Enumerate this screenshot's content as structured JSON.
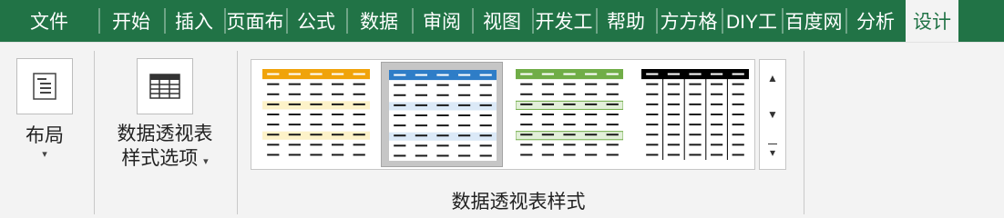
{
  "tabs": [
    {
      "id": "file",
      "label": "文件"
    },
    {
      "id": "home",
      "label": "开始"
    },
    {
      "id": "insert",
      "label": "插入"
    },
    {
      "id": "layout",
      "label": "页面布"
    },
    {
      "id": "formulas",
      "label": "公式"
    },
    {
      "id": "data",
      "label": "数据"
    },
    {
      "id": "review",
      "label": "审阅"
    },
    {
      "id": "view",
      "label": "视图"
    },
    {
      "id": "developer",
      "label": "开发工"
    },
    {
      "id": "help",
      "label": "帮助"
    },
    {
      "id": "fangfang",
      "label": "方方格"
    },
    {
      "id": "diy",
      "label": "DIY工"
    },
    {
      "id": "baidu",
      "label": "百度网"
    },
    {
      "id": "analyze",
      "label": "分析"
    },
    {
      "id": "design",
      "label": "设计"
    }
  ],
  "active_tab": "design",
  "ribbon": {
    "layout_button": {
      "label": "布局",
      "caret": "▾",
      "icon": "report-layout-icon"
    },
    "style_options_button": {
      "line1": "数据透视表",
      "line2": "样式选项",
      "caret": "▾",
      "icon": "table-grid-icon"
    },
    "styles_group": {
      "label": "数据透视表样式",
      "styles": [
        {
          "id": "orange-light",
          "accent": "#f0a30a",
          "band": "#fdf2c8"
        },
        {
          "id": "blue-light",
          "accent": "#2e7dc7",
          "band": "#dbe9f7",
          "selected": true
        },
        {
          "id": "green-light",
          "accent": "#70ad47",
          "band": "#e2efd9"
        },
        {
          "id": "black-medium",
          "accent": "#000000",
          "band": "#ffffff"
        }
      ],
      "scroll_up": "▲",
      "scroll_down": "▼",
      "more": "▾"
    }
  }
}
